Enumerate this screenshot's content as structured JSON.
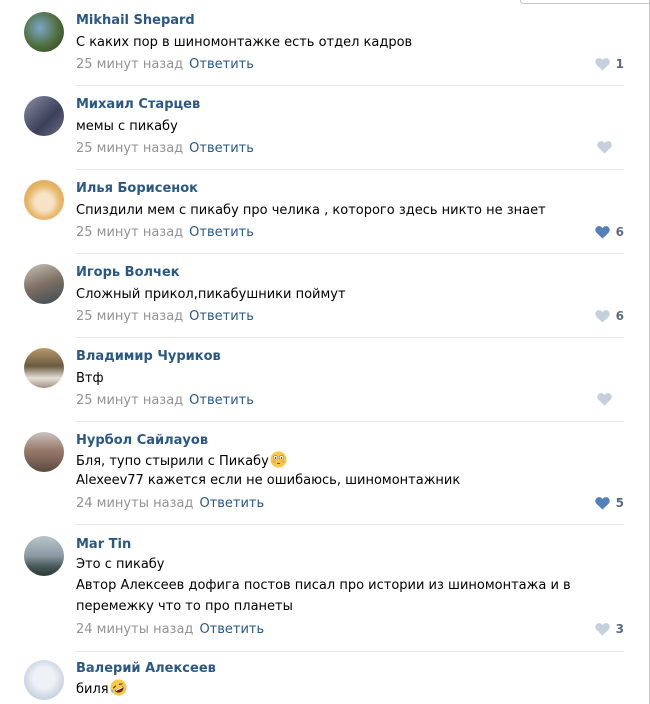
{
  "comments": [
    {
      "author": "Mikhail Shepard",
      "lines": [
        "С каких пор в шиномонтажке есть отдел кадров"
      ],
      "time": "25 минут назад",
      "reply": "Ответить",
      "likes": "1",
      "liked": false
    },
    {
      "author": "Михаил Старцев",
      "lines": [
        "мемы с пикабу"
      ],
      "time": "25 минут назад",
      "reply": "Ответить",
      "likes": "",
      "liked": false
    },
    {
      "author": "Илья Борисенок",
      "lines": [
        "Спиздили мем с пикабу про челика , которого здесь никто не знает"
      ],
      "time": "25 минут назад",
      "reply": "Ответить",
      "likes": "6",
      "liked": true
    },
    {
      "author": "Игорь Волчек",
      "lines": [
        "Сложный прикол,пикабушники поймут"
      ],
      "time": "25 минут назад",
      "reply": "Ответить",
      "likes": "6",
      "liked": false
    },
    {
      "author": "Владимир Чуриков",
      "lines": [
        "Втф"
      ],
      "time": "25 минут назад",
      "reply": "Ответить",
      "likes": "",
      "liked": false
    },
    {
      "author": "Нурбол Сайлауов",
      "lines": [
        "Бля, тупо стырили с Пикабу",
        "Alexeev77 кажется если не ошибаюсь, шиномонтажник"
      ],
      "time": "24 минуты назад",
      "reply": "Ответить",
      "likes": "5",
      "liked": true
    },
    {
      "author": "Mar Tin",
      "lines": [
        "Это с пикабу",
        "Автор Алексеев дофига постов писал про истории из шиномонтажа и в",
        "перемежку что то про планеты"
      ],
      "time": "24 минуты назад",
      "reply": "Ответить",
      "likes": "3",
      "liked": false
    },
    {
      "author": "Валерий Алексеев",
      "lines": [
        "биля"
      ],
      "time": "",
      "reply": "",
      "likes": "",
      "liked": false
    }
  ],
  "colors": {
    "link": "#2a5885",
    "meta": "#939393",
    "heart_active": "#5181b8",
    "heart_inactive": "#c4d0dd"
  }
}
